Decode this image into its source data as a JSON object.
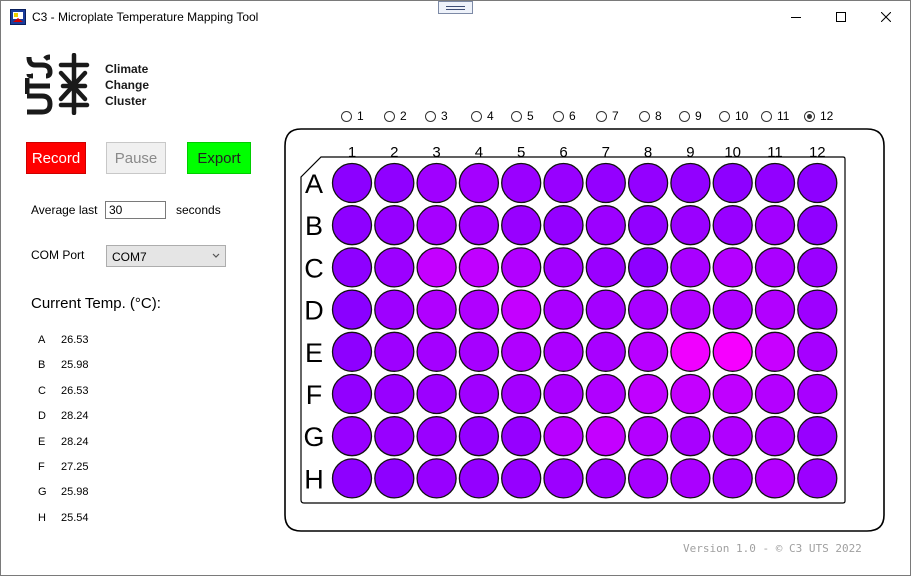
{
  "window": {
    "title": "C3 - Microplate Temperature Mapping Tool"
  },
  "logo": {
    "lines": [
      "Climate",
      "Change",
      "Cluster"
    ],
    "brand_letters": "UTS"
  },
  "controls": {
    "record_label": "Record",
    "pause_label": "Pause",
    "export_label": "Export",
    "average_label": "Average last",
    "average_value": "30",
    "seconds_label": "seconds",
    "com_label": "COM Port",
    "com_value": "COM7"
  },
  "current_temp": {
    "title": "Current Temp. (°C):",
    "rows": [
      {
        "row": "A",
        "value": "26.53"
      },
      {
        "row": "B",
        "value": "25.98"
      },
      {
        "row": "C",
        "value": "26.53"
      },
      {
        "row": "D",
        "value": "28.24"
      },
      {
        "row": "E",
        "value": "28.24"
      },
      {
        "row": "F",
        "value": "27.25"
      },
      {
        "row": "G",
        "value": "25.98"
      },
      {
        "row": "H",
        "value": "25.54"
      }
    ]
  },
  "column_selector": {
    "options": [
      "1",
      "2",
      "3",
      "4",
      "5",
      "6",
      "7",
      "8",
      "9",
      "10",
      "11",
      "12"
    ],
    "selected": "12"
  },
  "plate": {
    "column_labels": [
      "1",
      "2",
      "3",
      "4",
      "5",
      "6",
      "7",
      "8",
      "9",
      "10",
      "11",
      "12"
    ],
    "row_labels": [
      "A",
      "B",
      "C",
      "D",
      "E",
      "F",
      "G",
      "H"
    ],
    "well_colors": [
      [
        "#8c00ff",
        "#9000ff",
        "#a000ff",
        "#a400ff",
        "#9a00ff",
        "#9800ff",
        "#9400ff",
        "#9400ff",
        "#9200ff",
        "#8e00ff",
        "#9200ff",
        "#8e00ff"
      ],
      [
        "#8e00ff",
        "#9600ff",
        "#a600ff",
        "#a200ff",
        "#9800ff",
        "#9400ff",
        "#9c00ff",
        "#9200ff",
        "#9a00ff",
        "#9800ff",
        "#a200ff",
        "#9000ff"
      ],
      [
        "#8e00ff",
        "#9c00ff",
        "#c400ff",
        "#c000ff",
        "#b200ff",
        "#a200ff",
        "#9a00ff",
        "#8e00ff",
        "#a800ff",
        "#b400ff",
        "#aa00ff",
        "#9a00ff"
      ],
      [
        "#8a00ff",
        "#9e00ff",
        "#b000ff",
        "#b000ff",
        "#c400ff",
        "#aa00ff",
        "#a400ff",
        "#a800ff",
        "#b000ff",
        "#ae00ff",
        "#b200ff",
        "#9e00ff"
      ],
      [
        "#8e00ff",
        "#9e00ff",
        "#a400ff",
        "#a600ff",
        "#b000ff",
        "#ac00ff",
        "#a800ff",
        "#b800ff",
        "#f000ff",
        "#f600ff",
        "#c800ff",
        "#a600ff"
      ],
      [
        "#9200ff",
        "#9800ff",
        "#9c00ff",
        "#a000ff",
        "#a400ff",
        "#aa00ff",
        "#b000ff",
        "#c000ff",
        "#c400ff",
        "#c000ff",
        "#b400ff",
        "#a800ff"
      ],
      [
        "#9800ff",
        "#9800ff",
        "#9a00ff",
        "#9400ff",
        "#9600ff",
        "#b800ff",
        "#c400ff",
        "#b400ff",
        "#a800ff",
        "#b000ff",
        "#aa00ff",
        "#9800ff"
      ],
      [
        "#8e00ff",
        "#8e00ff",
        "#9800ff",
        "#9400ff",
        "#9600ff",
        "#9c00ff",
        "#a000ff",
        "#a600ff",
        "#aa00ff",
        "#a400ff",
        "#b400ff",
        "#9c00ff"
      ]
    ]
  },
  "footer": {
    "version": "Version 1.0 - © C3 UTS 2022"
  }
}
